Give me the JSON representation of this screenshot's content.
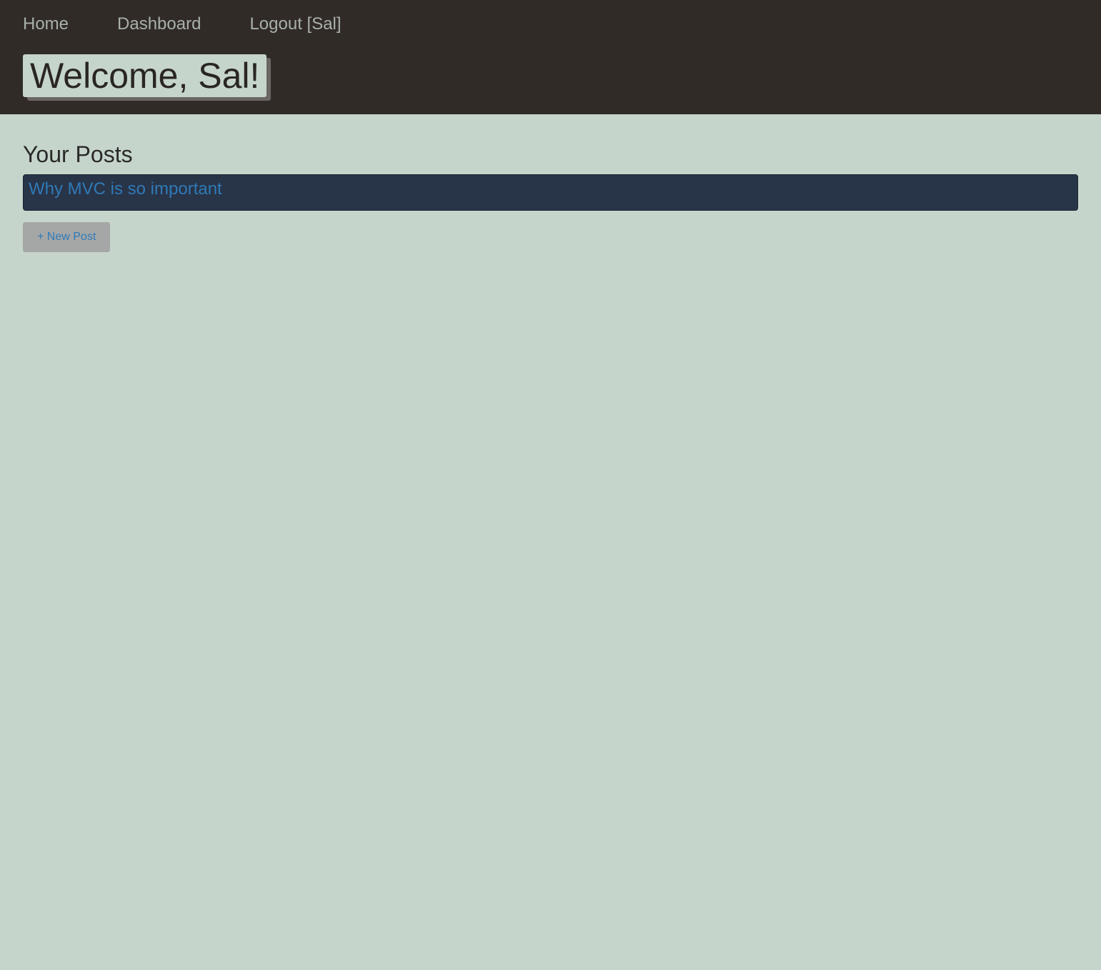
{
  "nav": {
    "items": [
      {
        "label": "Home"
      },
      {
        "label": "Dashboard"
      },
      {
        "label": "Logout [Sal]"
      }
    ]
  },
  "header": {
    "welcome": "Welcome, Sal!"
  },
  "main": {
    "section_title": "Your Posts",
    "posts": [
      {
        "title": "Why MVC is so important"
      }
    ],
    "new_post_label": "+ New Post"
  },
  "colors": {
    "header_bg": "#312b28",
    "page_bg": "#c6d5cb",
    "post_row_bg": "#283447",
    "link": "#2f7ab8",
    "button_bg": "#a5a7a6"
  }
}
